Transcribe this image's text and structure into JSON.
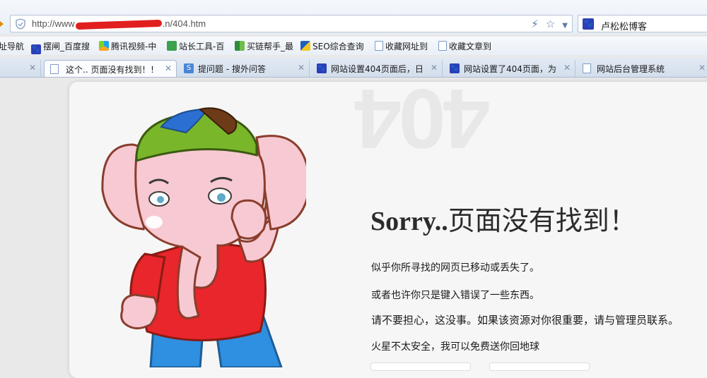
{
  "address_bar": {
    "url_prefix": "http://www",
    "url_suffix": ".n/404.htm",
    "icons": [
      "lightning-icon",
      "star-icon",
      "dropdown-icon"
    ]
  },
  "search": {
    "engine_icon": "baidu-paw-icon",
    "query": "卢松松博客"
  },
  "favorites": [
    {
      "label": "址导航",
      "icon": "none"
    },
    {
      "label": "摆闸_百度搜",
      "icon": "baidu-paw-icon"
    },
    {
      "label": "腾讯视频-中",
      "icon": "tencent-video-icon"
    },
    {
      "label": "站长工具-百",
      "icon": "chinaz-icon"
    },
    {
      "label": "买链帮手_最",
      "icon": "grid-icon"
    },
    {
      "label": "SEO综合查询",
      "icon": "seo-icon"
    },
    {
      "label": "收藏网址到",
      "icon": "page-icon"
    },
    {
      "label": "收藏文章到",
      "icon": "page-icon"
    }
  ],
  "tabs": [
    {
      "label": "这个.. 页面没有找到！！",
      "active": true,
      "icon": "page-icon"
    },
    {
      "label": "提问题 - 搜外问答",
      "active": false,
      "icon": "sowai-icon"
    },
    {
      "label": "网站设置404页面后，日",
      "active": false,
      "icon": "baidu-paw-icon"
    },
    {
      "label": "网站设置了404页面，为",
      "active": false,
      "icon": "baidu-paw-icon"
    },
    {
      "label": "网站后台管理系统",
      "active": false,
      "icon": "page-icon"
    }
  ],
  "page": {
    "ghost_text": "404",
    "heading_en": "Sorry..",
    "heading_cn": "页面没有找到！",
    "messages": [
      "似乎你所寻找的网页已移动或丢失了。",
      "或者也许你只是键入错误了一些东西。",
      "请不要担心，这没事。如果该资源对你很重要，请与管理员联系。",
      "火星不太安全，我可以免费送你回地球"
    ]
  },
  "colors": {
    "redaction": "#e11f1f",
    "baidu_blue": "#2b3fb8",
    "card_bg": "#f6f6f6",
    "page_bg": "#e9e9e9"
  }
}
